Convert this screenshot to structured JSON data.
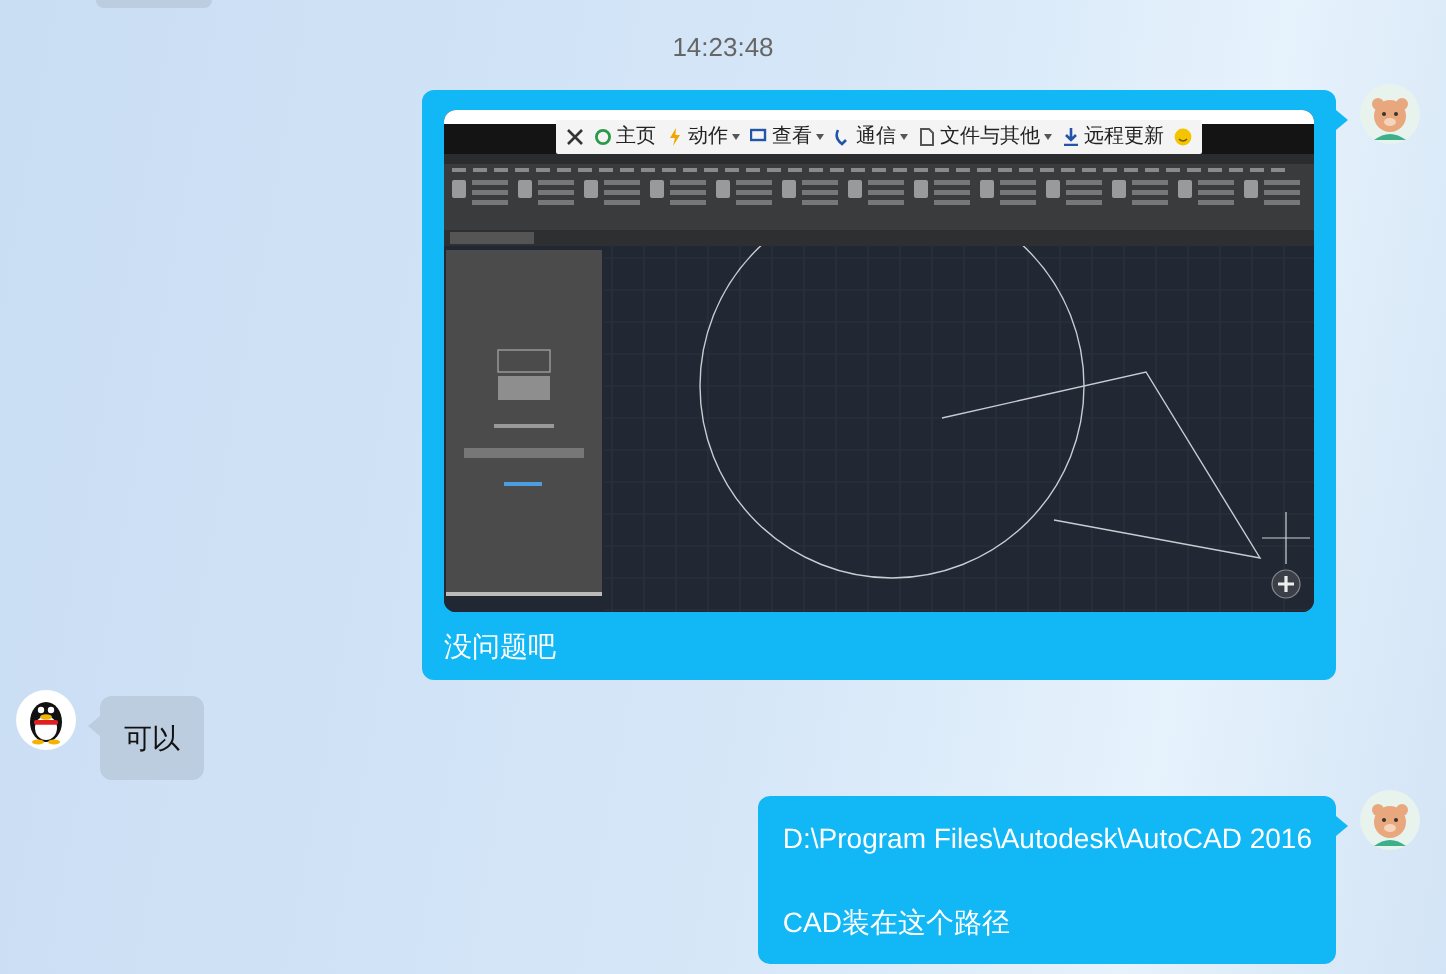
{
  "messages": [
    {
      "kind": "clipped"
    },
    {
      "kind": "timestamp",
      "text": "14:23:48"
    },
    {
      "kind": "outgoing",
      "text": "没问题吧",
      "screenshot": {
        "toolbar": [
          {
            "label": "主页",
            "dropdown": false
          },
          {
            "label": "动作",
            "dropdown": true
          },
          {
            "label": "查看",
            "dropdown": true
          },
          {
            "label": "通信",
            "dropdown": true
          },
          {
            "label": "文件与其他",
            "dropdown": true
          },
          {
            "label": "远程更新",
            "dropdown": false
          }
        ]
      }
    },
    {
      "kind": "incoming",
      "paragraphs": [
        "可以"
      ]
    },
    {
      "kind": "outgoing",
      "paragraphs": [
        "D:\\Program Files\\Autodesk\\AutoCAD 2016",
        "CAD装在这个路径"
      ]
    }
  ]
}
